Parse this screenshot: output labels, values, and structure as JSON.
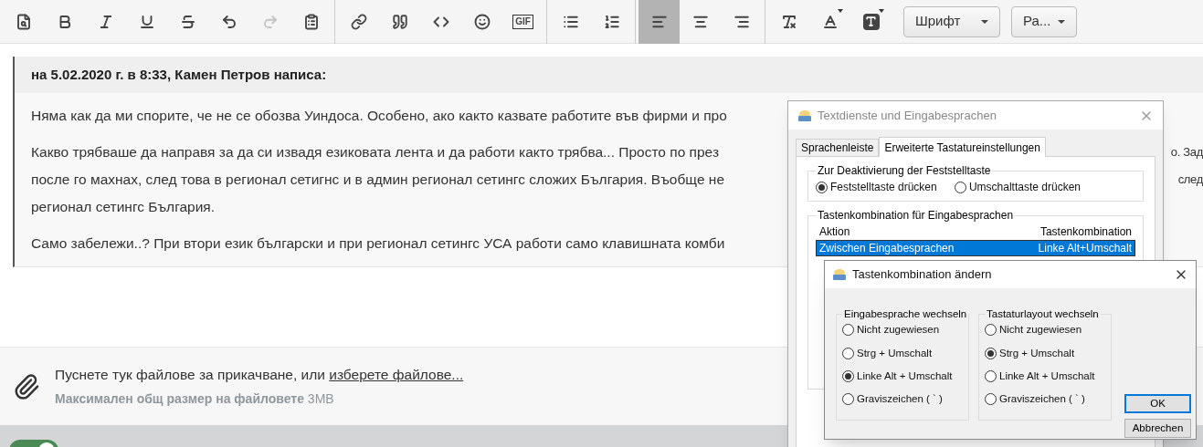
{
  "toolbar": {
    "groups": [
      [
        {
          "kind": "preview",
          "selected": false,
          "disabled": false
        },
        {
          "kind": "bold",
          "selected": false,
          "disabled": false
        },
        {
          "kind": "italic",
          "selected": false,
          "disabled": false
        },
        {
          "kind": "underline",
          "selected": false,
          "disabled": false
        },
        {
          "kind": "strike",
          "selected": false,
          "disabled": false
        },
        {
          "kind": "undo",
          "selected": false,
          "disabled": false
        },
        {
          "kind": "redo",
          "selected": false,
          "disabled": true
        },
        {
          "kind": "paste",
          "selected": false,
          "disabled": false
        }
      ],
      [
        {
          "kind": "link",
          "selected": false,
          "disabled": false
        },
        {
          "kind": "quote",
          "selected": false,
          "disabled": false
        },
        {
          "kind": "code",
          "selected": false,
          "disabled": false
        },
        {
          "kind": "smiley",
          "selected": false,
          "disabled": false
        },
        {
          "kind": "gif",
          "label": "GIF",
          "selected": false,
          "disabled": false
        }
      ],
      [
        {
          "kind": "bullets",
          "selected": false,
          "disabled": false
        },
        {
          "kind": "numbers",
          "selected": false,
          "disabled": false
        }
      ],
      [
        {
          "kind": "align-left",
          "selected": true,
          "disabled": false
        },
        {
          "kind": "align-center",
          "selected": false,
          "disabled": false
        },
        {
          "kind": "align-right",
          "selected": false,
          "disabled": false
        }
      ],
      [
        {
          "kind": "clear",
          "selected": false,
          "disabled": false
        },
        {
          "kind": "text-color",
          "selected": false,
          "disabled": false
        },
        {
          "kind": "bg-color",
          "selected": false,
          "disabled": false
        }
      ]
    ],
    "dropdowns": [
      {
        "label": "Шрифт"
      },
      {
        "label": "Ра..."
      }
    ]
  },
  "quote": {
    "header": "на 5.02.2020 г. в 8:33, Камен Петров написа:",
    "paragraphs": [
      {
        "lines": [
          {
            "text": "Няма как да ми спорите, че не се обозва Уиндоса. Особено, ако както казвате работите във фирми и про"
          }
        ]
      },
      {
        "lines": [
          {
            "text": "Какво трябваше да направя за да си извадя езиковата лента и да работи както трябва... Просто по през",
            "tail": "о. Зад"
          },
          {
            "text": "после го махнах, след това в регионал сетигнс и в админ регионал сетингс сложих България. Въобще не",
            "tail": "след"
          },
          {
            "text": "регионал сетингс България."
          }
        ]
      },
      {
        "lines": [
          {
            "text": "Само забележи..? При втори език български и при регионал сетингс УСА работи само клавишната комби"
          }
        ]
      }
    ]
  },
  "attachments": {
    "prompt": "Пуснете тук файлове за прикачване, или",
    "link": "изберете файлове...",
    "limit": "**Максимален общ размер на файловете** 3MB"
  },
  "toggle": {
    "on": true
  },
  "text_services_dialog": {
    "title": "Textdienste und Eingabesprachen",
    "tabs": [
      {
        "label": "Sprachenleiste",
        "selected": false
      },
      {
        "label": "Erweiterte Tastatureinstellungen",
        "selected": true
      }
    ],
    "caps_group": {
      "title": "Zur Deaktivierung der Feststelltaste",
      "options": [
        {
          "label": "Feststelltaste drücken",
          "selected": true
        },
        {
          "label": "Umschalttaste drücken",
          "selected": false
        }
      ]
    },
    "hotkeys_group": {
      "title": "Tastenkombination für Eingabesprachen",
      "columns": [
        "Aktion",
        "Tastenkombination"
      ],
      "rows": [
        {
          "action": "Zwischen Eingabesprachen",
          "keys": "Linke Alt+Umschalt",
          "selected": true
        }
      ]
    }
  },
  "change_dialog": {
    "title": "Tastenkombination ändern",
    "groups": [
      {
        "title": "Eingabesprache wechseln",
        "options": [
          {
            "label": "Nicht zugewiesen",
            "selected": false
          },
          {
            "label": "Strg + Umschalt",
            "selected": false
          },
          {
            "label": "Linke Alt + Umschalt",
            "selected": true
          },
          {
            "label": "Graviszeichen ( ` )",
            "selected": false
          }
        ]
      },
      {
        "title": "Tastaturlayout wechseln",
        "options": [
          {
            "label": "Nicht zugewiesen",
            "selected": false
          },
          {
            "label": "Strg + Umschalt",
            "selected": true
          },
          {
            "label": "Linke Alt + Umschalt",
            "selected": false
          },
          {
            "label": "Graviszeichen ( ` )",
            "selected": false
          }
        ]
      }
    ],
    "buttons": [
      {
        "label": "OK",
        "kind": "default"
      },
      {
        "label": "Abbrechen",
        "kind": "normal"
      }
    ]
  }
}
